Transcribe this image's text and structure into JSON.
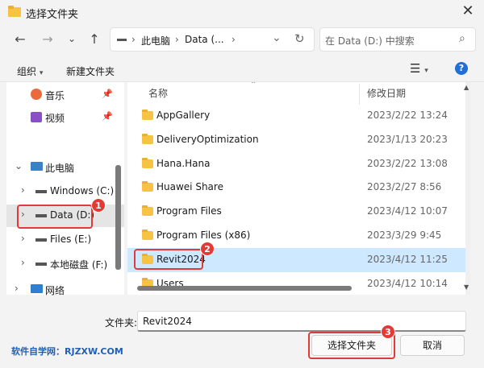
{
  "window": {
    "title": "选择文件夹",
    "close_symbol": "✕"
  },
  "address": {
    "segments": [
      "此电脑",
      "Data (..."
    ]
  },
  "search": {
    "placeholder": "在 Data (D:) 中搜索"
  },
  "toolbar": {
    "organize": "组织",
    "organize_caret": "▾",
    "new_folder": "新建文件夹",
    "help": "?"
  },
  "nav": {
    "items": [
      {
        "label": "音乐",
        "pinned": true
      },
      {
        "label": "视频",
        "pinned": true
      },
      {
        "label": "此电脑"
      },
      {
        "label": "Windows (C:)"
      },
      {
        "label": "Data (D:)",
        "selected": true
      },
      {
        "label": "Files (E:)"
      },
      {
        "label": "本地磁盘 (F:)"
      },
      {
        "label": "网络"
      }
    ]
  },
  "columns": {
    "name": "名称",
    "modified": "修改日期"
  },
  "files": [
    {
      "name": "AppGallery",
      "date": "2023/2/22 13:24"
    },
    {
      "name": "DeliveryOptimization",
      "date": "2023/1/13 20:23"
    },
    {
      "name": "Hana.Hana",
      "date": "2023/2/22 13:08"
    },
    {
      "name": "Huawei Share",
      "date": "2023/2/27 8:56"
    },
    {
      "name": "Program Files",
      "date": "2023/4/12 10:07"
    },
    {
      "name": "Program Files (x86)",
      "date": "2023/3/29 9:45"
    },
    {
      "name": "Revit2024",
      "date": "2023/4/12 11:25",
      "selected": true
    },
    {
      "name": "Users",
      "date": "2023/4/12 10:14"
    }
  ],
  "footer": {
    "folder_label": "文件夹:",
    "folder_value": "Revit2024",
    "select_button": "选择文件夹",
    "cancel_button": "取消"
  },
  "watermark": "软件自学网：RJZXW.COM",
  "annotations": [
    "1",
    "2",
    "3"
  ],
  "colors": {
    "accent": "#1f6fd6",
    "selection": "#cde8ff",
    "highlight": "#e03a3a",
    "folder": "#f6c344"
  }
}
